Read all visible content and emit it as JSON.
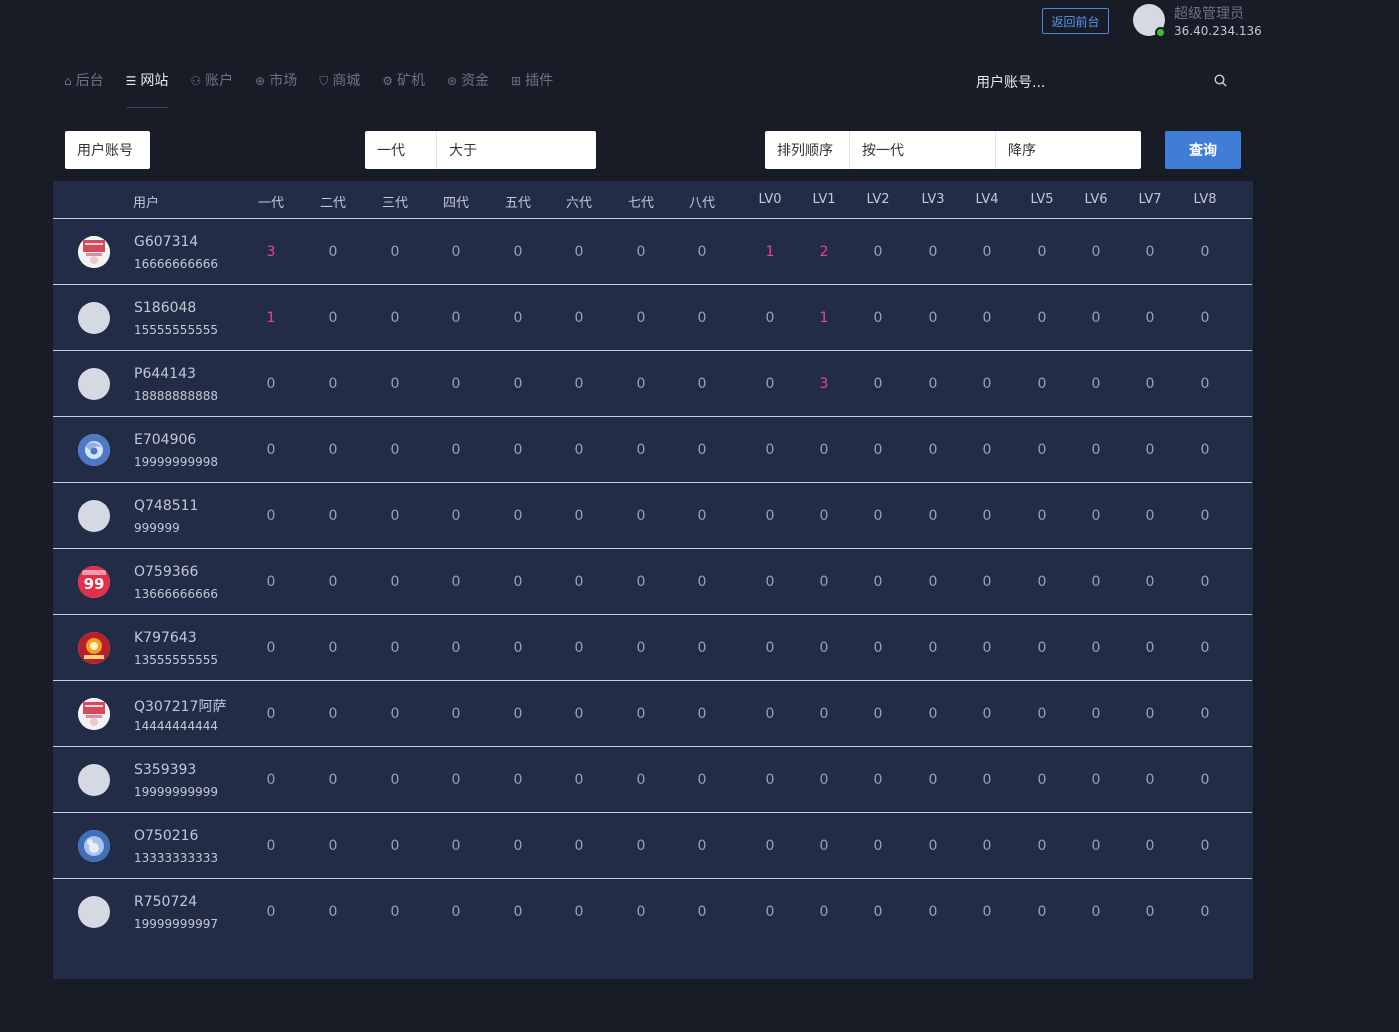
{
  "header": {
    "back_label": "返回前台",
    "admin_name": "超级管理员",
    "admin_ip": "36.40.234.136"
  },
  "nav": [
    {
      "label": "后台",
      "icon": "home-icon"
    },
    {
      "label": "网站",
      "icon": "list-icon",
      "active": true
    },
    {
      "label": "账户",
      "icon": "users-icon"
    },
    {
      "label": "市场",
      "icon": "globe-icon"
    },
    {
      "label": "商城",
      "icon": "cart-icon"
    },
    {
      "label": "矿机",
      "icon": "chip-icon"
    },
    {
      "label": "资金",
      "icon": "money-icon"
    },
    {
      "label": "插件",
      "icon": "grid-icon"
    }
  ],
  "search": {
    "placeholder": "用户账号..."
  },
  "filters": {
    "account_label": "用户账号",
    "generation": "一代",
    "comparison": "大于",
    "comparison_value": "",
    "sort_label": "排列顺序",
    "sort_by": "按一代",
    "sort_dir": "降序",
    "query_label": "查询"
  },
  "colors": {
    "highlight": "#e8488a",
    "primary": "#3f7dd6",
    "panel": "#232c47"
  },
  "table": {
    "columns": [
      "用户",
      "一代",
      "二代",
      "三代",
      "四代",
      "五代",
      "六代",
      "七代",
      "八代",
      "LV0",
      "LV1",
      "LV2",
      "LV3",
      "LV4",
      "LV5",
      "LV6",
      "LV7",
      "LV8"
    ],
    "rows": [
      {
        "name": "G607314",
        "phone": "16666666666",
        "avatar": "poster",
        "values": [
          3,
          0,
          0,
          0,
          0,
          0,
          0,
          0,
          1,
          2,
          0,
          0,
          0,
          0,
          0,
          0,
          0
        ]
      },
      {
        "name": "S186048",
        "phone": "15555555555",
        "avatar": "blank",
        "values": [
          1,
          0,
          0,
          0,
          0,
          0,
          0,
          0,
          0,
          1,
          0,
          0,
          0,
          0,
          0,
          0,
          0
        ]
      },
      {
        "name": "P644143",
        "phone": "18888888888",
        "avatar": "blank",
        "values": [
          0,
          0,
          0,
          0,
          0,
          0,
          0,
          0,
          0,
          3,
          0,
          0,
          0,
          0,
          0,
          0,
          0
        ]
      },
      {
        "name": "E704906",
        "phone": "19999999998",
        "avatar": "blue-swirl",
        "values": [
          0,
          0,
          0,
          0,
          0,
          0,
          0,
          0,
          0,
          0,
          0,
          0,
          0,
          0,
          0,
          0,
          0
        ]
      },
      {
        "name": "Q748511",
        "phone": "999999",
        "avatar": "blank",
        "values": [
          0,
          0,
          0,
          0,
          0,
          0,
          0,
          0,
          0,
          0,
          0,
          0,
          0,
          0,
          0,
          0,
          0
        ]
      },
      {
        "name": "O759366",
        "phone": "13666666666",
        "avatar": "badge-99",
        "avatar_text": "99",
        "values": [
          0,
          0,
          0,
          0,
          0,
          0,
          0,
          0,
          0,
          0,
          0,
          0,
          0,
          0,
          0,
          0,
          0
        ]
      },
      {
        "name": "K797643",
        "phone": "13555555555",
        "avatar": "red-festive",
        "values": [
          0,
          0,
          0,
          0,
          0,
          0,
          0,
          0,
          0,
          0,
          0,
          0,
          0,
          0,
          0,
          0,
          0
        ]
      },
      {
        "name": "Q307217阿萨",
        "phone": "14444444444",
        "avatar": "poster",
        "values": [
          0,
          0,
          0,
          0,
          0,
          0,
          0,
          0,
          0,
          0,
          0,
          0,
          0,
          0,
          0,
          0,
          0
        ]
      },
      {
        "name": "S359393",
        "phone": "19999999999",
        "avatar": "blank",
        "values": [
          0,
          0,
          0,
          0,
          0,
          0,
          0,
          0,
          0,
          0,
          0,
          0,
          0,
          0,
          0,
          0,
          0
        ]
      },
      {
        "name": "O750216",
        "phone": "13333333333",
        "avatar": "blue-orb",
        "values": [
          0,
          0,
          0,
          0,
          0,
          0,
          0,
          0,
          0,
          0,
          0,
          0,
          0,
          0,
          0,
          0,
          0
        ]
      },
      {
        "name": "R750724",
        "phone": "19999999997",
        "avatar": "blank",
        "values": [
          0,
          0,
          0,
          0,
          0,
          0,
          0,
          0,
          0,
          0,
          0,
          0,
          0,
          0,
          0,
          0,
          0
        ]
      }
    ]
  }
}
